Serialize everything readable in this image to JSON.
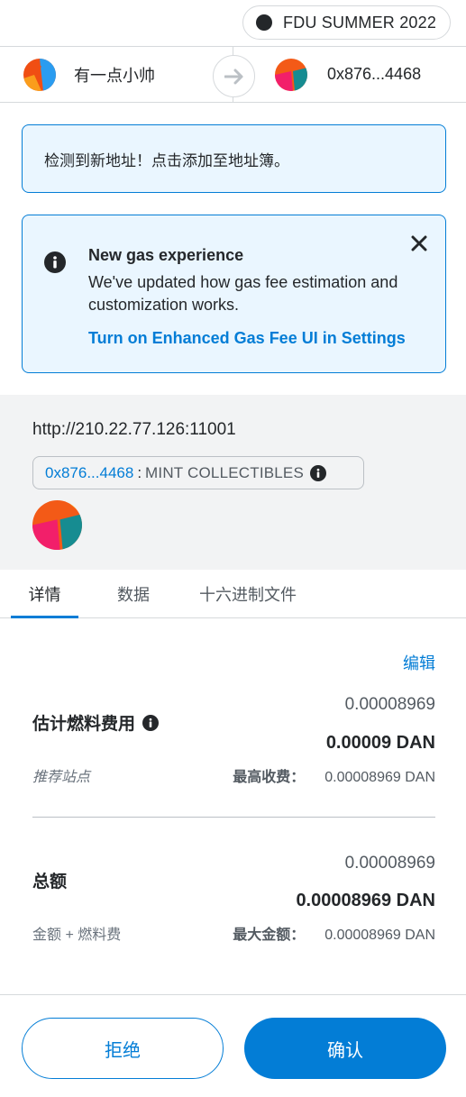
{
  "network": {
    "name": "FDU SUMMER 2022"
  },
  "sender": {
    "name": "有一点小帅"
  },
  "recipient": {
    "address": "0x876...4468"
  },
  "alerts": {
    "new_address": "检测到新地址！点击添加至地址簿。",
    "gas_title": "New gas experience",
    "gas_desc": "We've updated how gas fee estimation and customization works.",
    "gas_link": "Turn on Enhanced Gas Fee UI in Settings"
  },
  "origin": {
    "url": "http://210.22.77.126:11001",
    "contract_address": "0x876...4468",
    "separator": ":",
    "method": "MINT COLLECTIBLES"
  },
  "tabs": [
    {
      "label": "详情",
      "active": true
    },
    {
      "label": "数据",
      "active": false
    },
    {
      "label": "十六进制文件",
      "active": false
    }
  ],
  "details": {
    "edit_label": "编辑",
    "gas": {
      "label": "估计燃料费用",
      "secondary": "0.00008969",
      "primary": "0.00009 DAN",
      "site_label": "推荐站点",
      "max_label": "最高收费：",
      "max_value": "0.00008969 DAN"
    },
    "total": {
      "label": "总额",
      "secondary": "0.00008969",
      "primary": "0.00008969 DAN",
      "sub_label": "金额 + 燃料费",
      "max_label": "最大金额：",
      "max_value": "0.00008969 DAN"
    }
  },
  "footer": {
    "reject": "拒绝",
    "confirm": "确认"
  },
  "colors": {
    "accent": "#037dd6",
    "alert_bg": "#eaf6ff",
    "origin_bg": "#f2f3f4"
  }
}
